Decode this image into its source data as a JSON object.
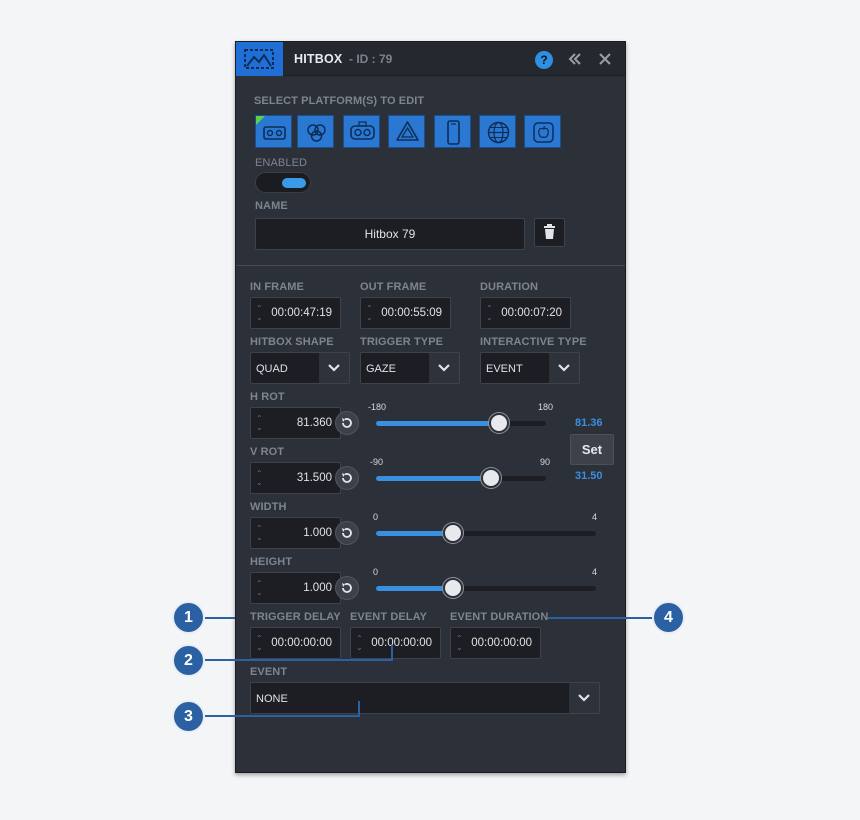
{
  "header": {
    "title": "HITBOX",
    "id_text": "- ID : 79",
    "help_label": "?"
  },
  "platforms": {
    "label": "SELECT PLATFORM(S) TO EDIT",
    "items": [
      {
        "icon": "vr-headset-icon"
      },
      {
        "icon": "oculus-icon"
      },
      {
        "icon": "gear-vr-icon"
      },
      {
        "icon": "vive-icon"
      },
      {
        "icon": "mobile-phone-icon"
      },
      {
        "icon": "web-globe-icon"
      },
      {
        "icon": "apple-icon"
      }
    ]
  },
  "enabled": {
    "label": "ENABLED",
    "on": true
  },
  "name": {
    "label": "NAME",
    "value": "Hitbox 79"
  },
  "timing": {
    "in_frame": {
      "label": "IN FRAME",
      "value": "00:00:47:19"
    },
    "out_frame": {
      "label": "OUT FRAME",
      "value": "00:00:55:09"
    },
    "duration": {
      "label": "DURATION",
      "value": "00:00:07:20"
    }
  },
  "selects": {
    "hitbox_shape": {
      "label": "HITBOX SHAPE",
      "value": "QUAD"
    },
    "trigger_type": {
      "label": "TRIGGER TYPE",
      "value": "GAZE"
    },
    "interactive_type": {
      "label": "INTERACTIVE TYPE",
      "value": "EVENT"
    }
  },
  "h_rot": {
    "label": "H ROT",
    "value": "81.360",
    "min": "-180",
    "max": "180",
    "current": "81.36",
    "fraction": 0.726
  },
  "v_rot": {
    "label": "V ROT",
    "value": "31.500",
    "min": "-90",
    "max": "90",
    "current": "31.50",
    "fraction": 0.675
  },
  "set_label": "Set",
  "width": {
    "label": "WIDTH",
    "value": "1.000",
    "min": "0",
    "max": "4",
    "fraction": 0.35
  },
  "height": {
    "label": "HEIGHT",
    "value": "1.000",
    "min": "0",
    "max": "4",
    "fraction": 0.35
  },
  "delays": {
    "trigger_delay": {
      "label": "TRIGGER DELAY",
      "value": "00:00:00:00"
    },
    "event_delay": {
      "label": "EVENT DELAY",
      "value": "00:00:00:00"
    },
    "event_duration": {
      "label": "EVENT DURATION",
      "value": "00:00:00:00"
    }
  },
  "event": {
    "label": "EVENT",
    "value": "NONE"
  },
  "callouts": [
    "1",
    "2",
    "3",
    "4"
  ],
  "colors": {
    "accent": "#3a8fe0",
    "brand": "#1f6fd6",
    "callout": "#2b61a3"
  }
}
